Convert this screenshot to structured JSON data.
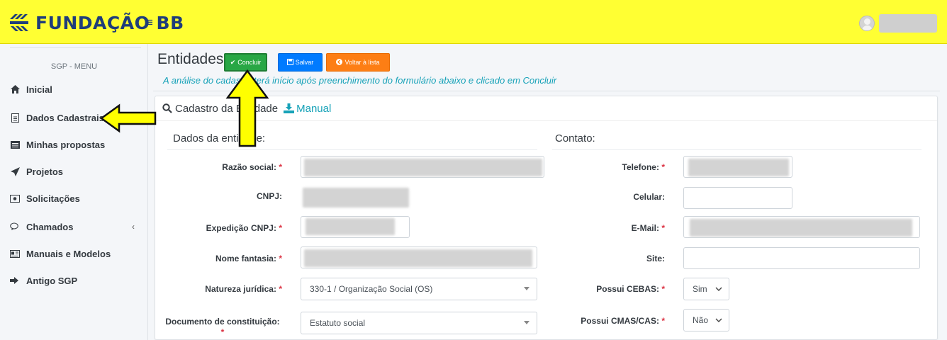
{
  "brand": {
    "name": "FUNDAÇÃO BB"
  },
  "topbar": {
    "menu_toggle_icon": "hamburger-icon",
    "user_icon": "user-avatar-icon"
  },
  "sidebar": {
    "header": "SGP - MENU",
    "items": [
      {
        "label": "Inicial",
        "icon": "home-icon"
      },
      {
        "label": "Dados Cadastrais",
        "icon": "document-icon"
      },
      {
        "label": "Minhas propostas",
        "icon": "list-icon"
      },
      {
        "label": "Projetos",
        "icon": "rocket-icon"
      },
      {
        "label": "Solicitações",
        "icon": "money-icon"
      },
      {
        "label": "Chamados",
        "icon": "chat-icon",
        "has_caret": true
      },
      {
        "label": "Manuais e Modelos",
        "icon": "card-icon"
      },
      {
        "label": "Antigo SGP",
        "icon": "sign-out-icon"
      }
    ]
  },
  "page": {
    "title": "Entidades",
    "buttons": {
      "concluir": "Concluir",
      "salvar": "Salvar",
      "voltar": "Voltar à lista"
    },
    "subtitle": "A análise do cadastro terá início após preenchimento do formulário abaixo e clicado em Concluir"
  },
  "card": {
    "header": "Cadastro da Entidade",
    "manual_link": "Manual",
    "left_section": "Dados da entidade:",
    "right_section": "Contato:",
    "left_fields": {
      "razao_social": "Razão social:",
      "cnpj": "CNPJ:",
      "expedicao_cnpj": "Expedição CNPJ:",
      "nome_fantasia": "Nome fantasia:",
      "natureza_juridica": "Natureza jurídica:",
      "documento_constituicao": "Documento de constituição:"
    },
    "left_values": {
      "natureza_juridica": "330-1 / Organização Social (OS)",
      "documento_constituicao": "Estatuto social"
    },
    "right_fields": {
      "telefone": "Telefone:",
      "celular": "Celular:",
      "email": "E-Mail:",
      "site": "Site:",
      "possui_cebas": "Possui CEBAS:",
      "possui_cmas": "Possui CMAS/CAS:"
    },
    "right_values": {
      "possui_cebas": "Sim",
      "possui_cmas": "Não"
    },
    "required_mark": "*"
  },
  "colors": {
    "topbar": "#ffff33",
    "brand": "#1f3d7a",
    "success": "#28a745",
    "primary": "#007bff",
    "warning": "#fd7e14",
    "info": "#17a2b8",
    "required": "#dc3545",
    "annotation_arrow": "#ffff00"
  }
}
